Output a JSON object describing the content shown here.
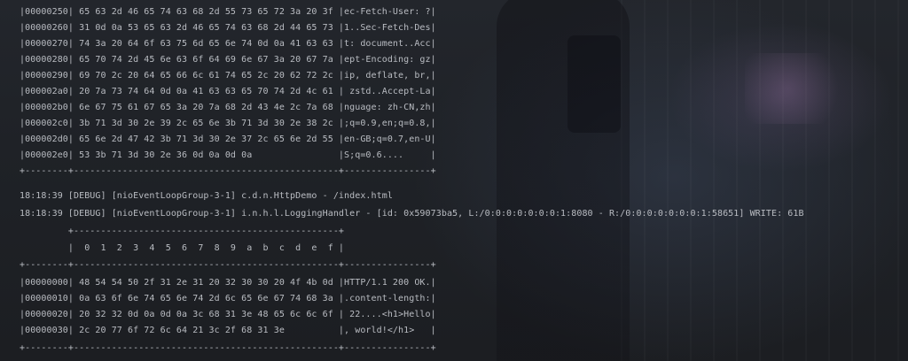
{
  "console": {
    "lines": [
      "|00000250| 65 63 2d 46 65 74 63 68 2d 55 73 65 72 3a 20 3f |ec-Fetch-User: ?|",
      "|00000260| 31 0d 0a 53 65 63 2d 46 65 74 63 68 2d 44 65 73 |1..Sec-Fetch-Des|",
      "|00000270| 74 3a 20 64 6f 63 75 6d 65 6e 74 0d 0a 41 63 63 |t: document..Acc|",
      "|00000280| 65 70 74 2d 45 6e 63 6f 64 69 6e 67 3a 20 67 7a |ept-Encoding: gz|",
      "|00000290| 69 70 2c 20 64 65 66 6c 61 74 65 2c 20 62 72 2c |ip, deflate, br,|",
      "|000002a0| 20 7a 73 74 64 0d 0a 41 63 63 65 70 74 2d 4c 61 | zstd..Accept-La|",
      "|000002b0| 6e 67 75 61 67 65 3a 20 7a 68 2d 43 4e 2c 7a 68 |nguage: zh-CN,zh|",
      "|000002c0| 3b 71 3d 30 2e 39 2c 65 6e 3b 71 3d 30 2e 38 2c |;q=0.9,en;q=0.8,|",
      "|000002d0| 65 6e 2d 47 42 3b 71 3d 30 2e 37 2c 65 6e 2d 55 |en-GB;q=0.7,en-U|",
      "|000002e0| 53 3b 71 3d 30 2e 36 0d 0a 0d 0a                |S;q=0.6....     |",
      "+--------+-------------------------------------------------+----------------+",
      "18:18:39 [DEBUG] [nioEventLoopGroup-3-1] c.d.n.HttpDemo - /index.html",
      "18:18:39 [DEBUG] [nioEventLoopGroup-3-1] i.n.h.l.LoggingHandler - [id: 0x59073ba5, L:/0:0:0:0:0:0:0:1:8080 - R:/0:0:0:0:0:0:0:1:58651] WRITE: 61B",
      "         +-------------------------------------------------+",
      "         |  0  1  2  3  4  5  6  7  8  9  a  b  c  d  e  f |",
      "+--------+-------------------------------------------------+----------------+",
      "|00000000| 48 54 54 50 2f 31 2e 31 20 32 30 30 20 4f 4b 0d |HTTP/1.1 200 OK.|",
      "|00000010| 0a 63 6f 6e 74 65 6e 74 2d 6c 65 6e 67 74 68 3a |.content-length:|",
      "|00000020| 20 32 32 0d 0a 0d 0a 3c 68 31 3e 48 65 6c 6c 6f | 22....<h1>Hello|",
      "|00000030| 2c 20 77 6f 72 6c 64 21 3c 2f 68 31 3e          |, world!</h1>   |",
      "+--------+-------------------------------------------------+----------------+"
    ]
  }
}
